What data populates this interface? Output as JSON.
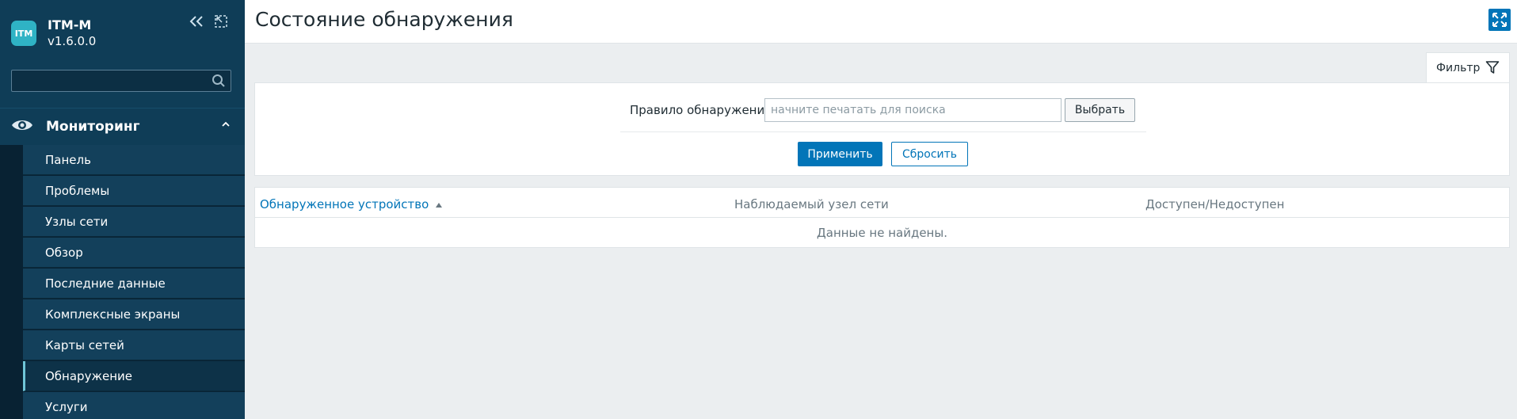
{
  "brand": {
    "logo_text": "ITM",
    "name": "ITM-M",
    "version": "v1.6.0.0"
  },
  "sidebar": {
    "search": {
      "value": "",
      "placeholder": ""
    },
    "section": {
      "label": "Мониторинг"
    },
    "items": [
      {
        "label": "Панель"
      },
      {
        "label": "Проблемы"
      },
      {
        "label": "Узлы сети"
      },
      {
        "label": "Обзор"
      },
      {
        "label": "Последние данные"
      },
      {
        "label": "Комплексные экраны"
      },
      {
        "label": "Карты сетей"
      },
      {
        "label": "Обнаружение",
        "active": true
      },
      {
        "label": "Услуги"
      }
    ]
  },
  "header": {
    "title": "Состояние обнаружения"
  },
  "filter": {
    "tab_label": "Фильтр",
    "rule_label": "Правило обнаружения",
    "rule_value": "",
    "rule_placeholder": "начните печатать для поиска",
    "select_label": "Выбрать",
    "apply_label": "Применить",
    "reset_label": "Сбросить"
  },
  "table": {
    "columns": [
      {
        "label": "Обнаруженное устройство",
        "sort": "asc"
      },
      {
        "label": "Наблюдаемый узел сети"
      },
      {
        "label": "Доступен/Недоступен"
      }
    ],
    "empty_text": "Данные не найдены."
  },
  "colors": {
    "sidebar_bg": "#0f3d57",
    "accent": "#0275b8",
    "logo_bg": "#2fb3c5"
  }
}
